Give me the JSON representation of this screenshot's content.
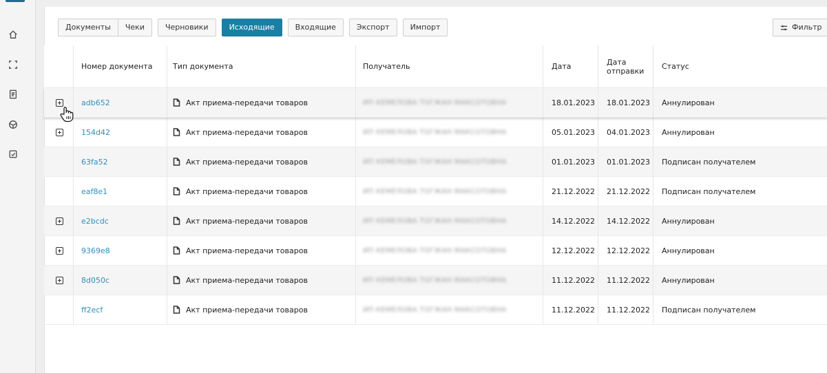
{
  "tabs": [
    {
      "label": "Документы",
      "active": false
    },
    {
      "label": "Чеки",
      "active": false
    },
    {
      "label": "Черновики",
      "active": false
    },
    {
      "label": "Исходящие",
      "active": true
    },
    {
      "label": "Входящие",
      "active": false
    },
    {
      "label": "Экспорт",
      "active": false
    },
    {
      "label": "Импорт",
      "active": false
    }
  ],
  "filter_label": "Фильтр",
  "columns": {
    "number": "Номер документа",
    "type": "Тип документа",
    "recipient": "Получатель",
    "date": "Дата",
    "sent_line1": "Дата",
    "sent_line2": "отправки",
    "status": "Статус"
  },
  "rows": [
    {
      "expand": true,
      "number": "adb652",
      "type": "Акт приема-передачи товаров",
      "recipient": "ИП КЕМЕЛОВА ТОГЖАН МАКСОТОВНА",
      "date": "18.01.2023",
      "sent": "18.01.2023",
      "status": "Аннулирован"
    },
    {
      "expand": true,
      "number": "154d42",
      "type": "Акт приема-передачи товаров",
      "recipient": "ИП КЕМЕЛОВА ТОГЖАН МАКСОТОВНА",
      "date": "05.01.2023",
      "sent": "04.01.2023",
      "status": "Аннулирован"
    },
    {
      "expand": false,
      "number": "63fa52",
      "type": "Акт приема-передачи товаров",
      "recipient": "ИП КЕМЕЛОВА ТОГЖАН МАКСОТОВНА",
      "date": "01.01.2023",
      "sent": "01.01.2023",
      "status": "Подписан получателем"
    },
    {
      "expand": false,
      "number": "eaf8e1",
      "type": "Акт приема-передачи товаров",
      "recipient": "ИП КЕМЕЛОВА ТОГЖАН МАКСОТОВНА",
      "date": "21.12.2022",
      "sent": "21.12.2022",
      "status": "Подписан получателем"
    },
    {
      "expand": true,
      "number": "e2bcdc",
      "type": "Акт приема-передачи товаров",
      "recipient": "ИП КЕМЕЛОВА ТОГЖАН МАКСОТОВНА",
      "date": "14.12.2022",
      "sent": "14.12.2022",
      "status": "Аннулирован"
    },
    {
      "expand": true,
      "number": "9369e8",
      "type": "Акт приема-передачи товаров",
      "recipient": "ИП КЕМЕЛОВА ТОГЖАН МАКСОТОВНА",
      "date": "12.12.2022",
      "sent": "12.12.2022",
      "status": "Аннулирован"
    },
    {
      "expand": true,
      "number": "8d050c",
      "type": "Акт приема-передачи товаров",
      "recipient": "ИП КЕМЕЛОВА ТОГЖАН МАКСОТОВНА",
      "date": "11.12.2022",
      "sent": "11.12.2022",
      "status": "Аннулирован"
    },
    {
      "expand": false,
      "number": "ff2ecf",
      "type": "Акт приема-передачи товаров",
      "recipient": "ИП КЕМЕЛОВА ТОГЖАН МАКСОТОВНА",
      "date": "11.12.2022",
      "sent": "11.12.2022",
      "status": "Подписан получателем"
    }
  ],
  "rail_icons": [
    "home-icon",
    "scan-icon",
    "document-icon",
    "package-icon",
    "checkbox-icon"
  ]
}
